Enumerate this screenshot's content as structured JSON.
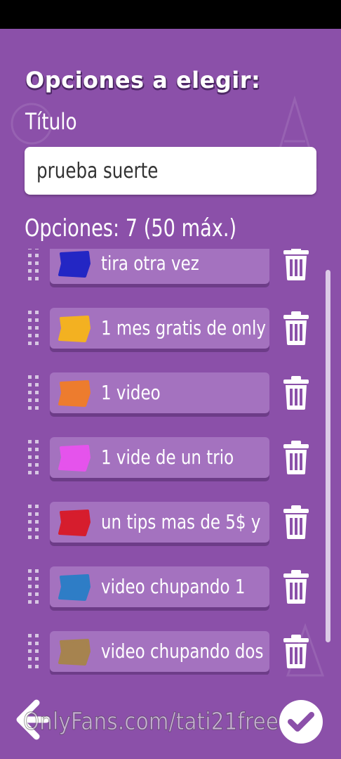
{
  "header": {
    "title": "Opciones a elegir:"
  },
  "title_field": {
    "label": "Título",
    "value": "prueba suerte"
  },
  "options_header": {
    "label": "Opciones: 7  (50 máx.)"
  },
  "options": [
    {
      "label": "tira otra vez",
      "color": "#2326c4"
    },
    {
      "label": "1 mes gratis de only",
      "color": "#f3b121"
    },
    {
      "label": "1 video",
      "color": "#ed7c2e"
    },
    {
      "label": "1 vide de un trio",
      "color": "#e553ec"
    },
    {
      "label": "un tips mas de 5$ y",
      "color": "#d61d2d"
    },
    {
      "label": "video chupando 1",
      "color": "#2e7dc6"
    },
    {
      "label": "video chupando dos",
      "color": "#a6834f"
    }
  ],
  "actions": {
    "back_icon": "arrow-left-icon",
    "confirm_icon": "checkmark-icon",
    "delete_icon": "trash-icon"
  },
  "watermark": {
    "text": "OnlyFans.com/tati21free"
  },
  "colors": {
    "background": "#8b50a9",
    "card": "#a472bf",
    "card_shadow": "#6d3c88"
  }
}
